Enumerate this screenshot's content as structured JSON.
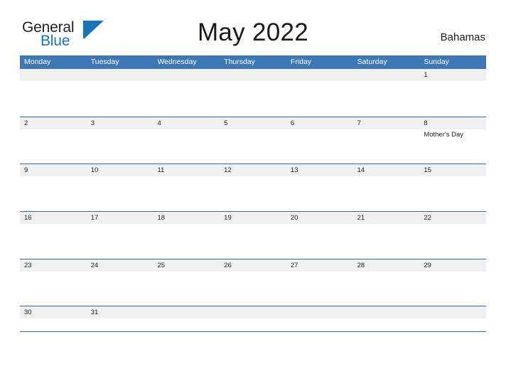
{
  "brand": {
    "name_part1": "General",
    "name_part2": "Blue",
    "flag_icon": "flag-icon",
    "color_dark": "#231f20",
    "color_blue": "#1b74bb"
  },
  "header": {
    "title": "May 2022",
    "region": "Bahamas"
  },
  "calendar": {
    "accent_color": "#3b78b5",
    "line_color": "#2e6da4",
    "band_color": "#f0f0f0",
    "weekdays": [
      "Monday",
      "Tuesday",
      "Wednesday",
      "Thursday",
      "Friday",
      "Saturday",
      "Sunday"
    ],
    "weeks": [
      {
        "days": [
          {
            "num": "",
            "events": []
          },
          {
            "num": "",
            "events": []
          },
          {
            "num": "",
            "events": []
          },
          {
            "num": "",
            "events": []
          },
          {
            "num": "",
            "events": []
          },
          {
            "num": "",
            "events": []
          },
          {
            "num": "1",
            "events": []
          }
        ]
      },
      {
        "days": [
          {
            "num": "2",
            "events": []
          },
          {
            "num": "3",
            "events": []
          },
          {
            "num": "4",
            "events": []
          },
          {
            "num": "5",
            "events": []
          },
          {
            "num": "6",
            "events": []
          },
          {
            "num": "7",
            "events": []
          },
          {
            "num": "8",
            "events": [
              "Mother's Day"
            ]
          }
        ]
      },
      {
        "days": [
          {
            "num": "9",
            "events": []
          },
          {
            "num": "10",
            "events": []
          },
          {
            "num": "11",
            "events": []
          },
          {
            "num": "12",
            "events": []
          },
          {
            "num": "13",
            "events": []
          },
          {
            "num": "14",
            "events": []
          },
          {
            "num": "15",
            "events": []
          }
        ]
      },
      {
        "days": [
          {
            "num": "16",
            "events": []
          },
          {
            "num": "17",
            "events": []
          },
          {
            "num": "18",
            "events": []
          },
          {
            "num": "19",
            "events": []
          },
          {
            "num": "20",
            "events": []
          },
          {
            "num": "21",
            "events": []
          },
          {
            "num": "22",
            "events": []
          }
        ]
      },
      {
        "days": [
          {
            "num": "23",
            "events": []
          },
          {
            "num": "24",
            "events": []
          },
          {
            "num": "25",
            "events": []
          },
          {
            "num": "26",
            "events": []
          },
          {
            "num": "27",
            "events": []
          },
          {
            "num": "28",
            "events": []
          },
          {
            "num": "29",
            "events": []
          }
        ]
      },
      {
        "days": [
          {
            "num": "30",
            "events": []
          },
          {
            "num": "31",
            "events": []
          },
          {
            "num": "",
            "events": []
          },
          {
            "num": "",
            "events": []
          },
          {
            "num": "",
            "events": []
          },
          {
            "num": "",
            "events": []
          },
          {
            "num": "",
            "events": []
          }
        ]
      }
    ]
  }
}
